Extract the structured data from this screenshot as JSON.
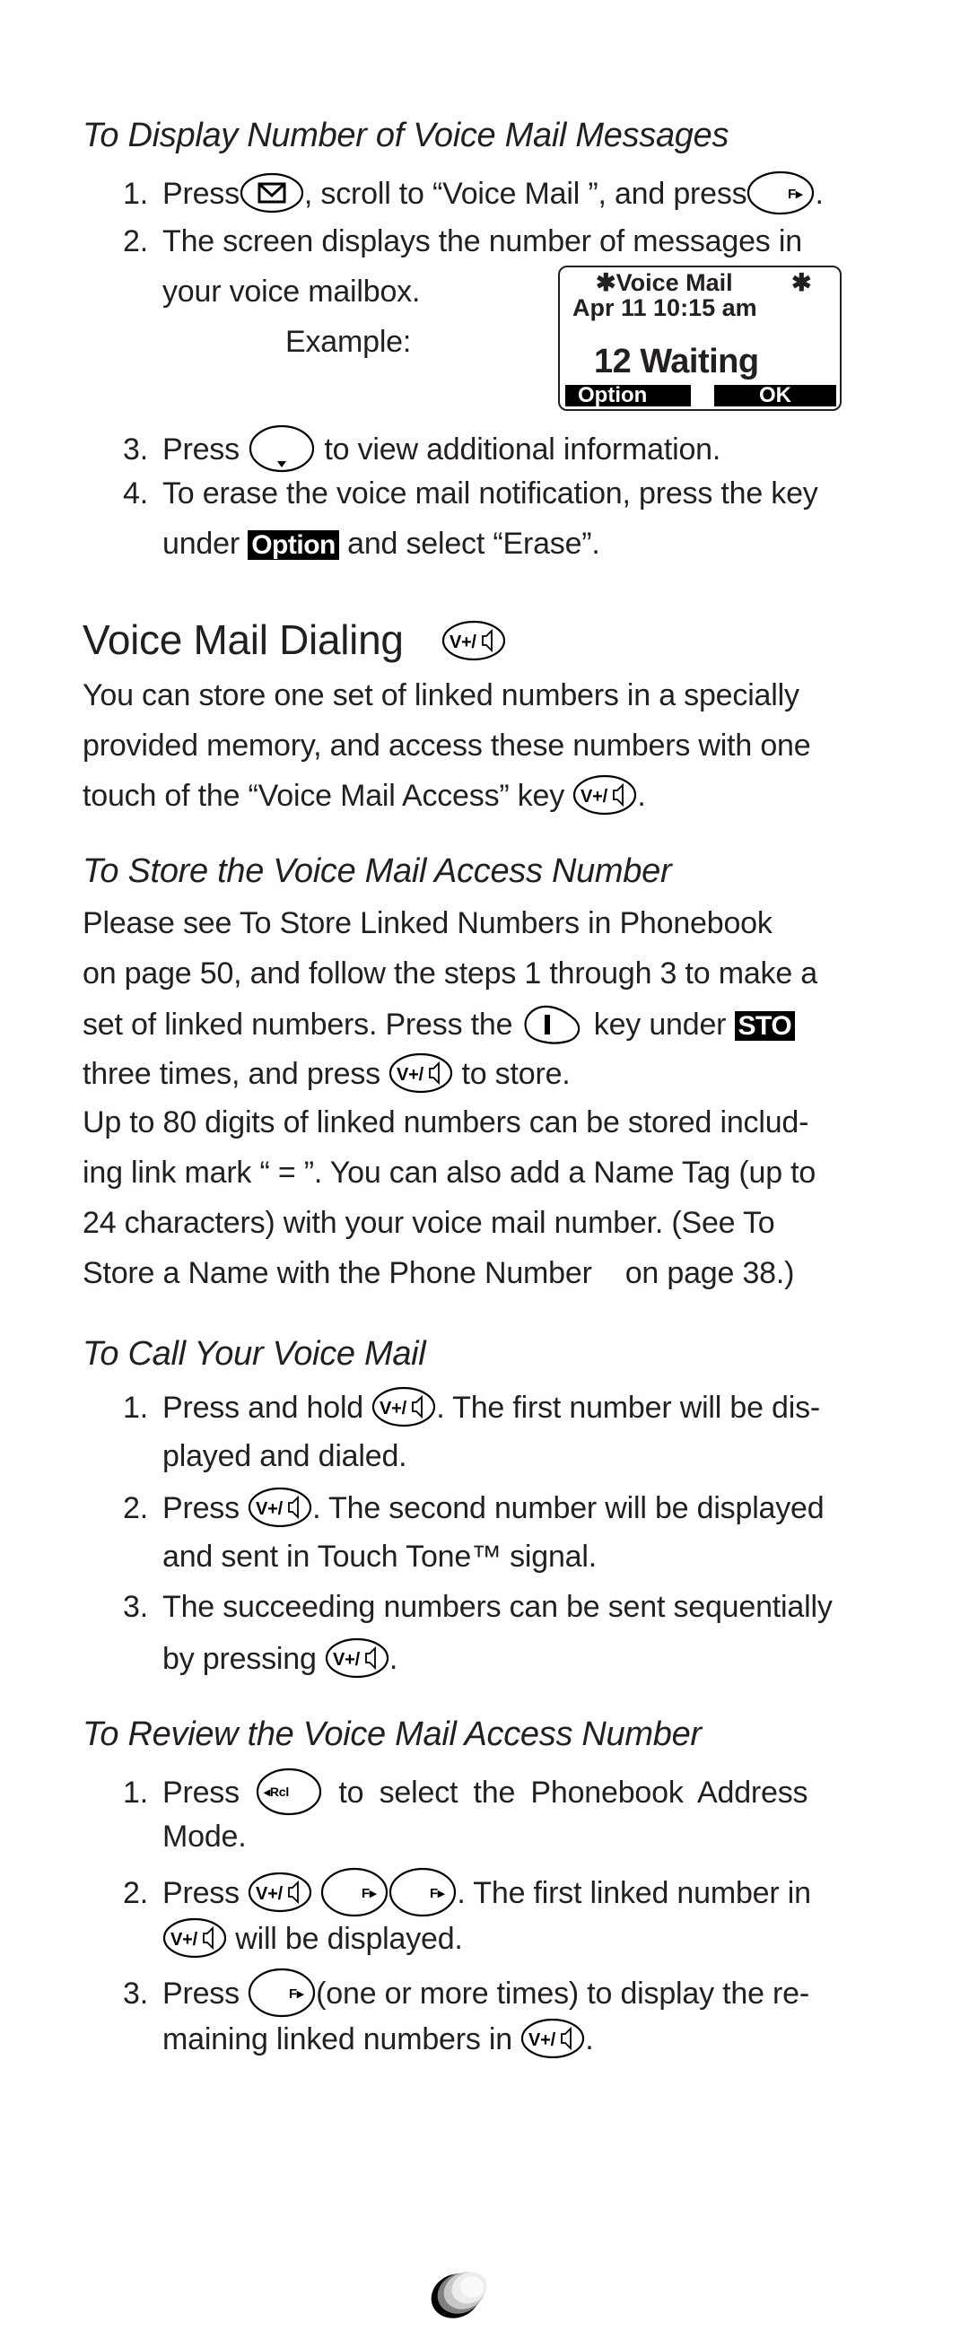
{
  "section_display": {
    "title": "To Display Number of Voice Mail Messages",
    "steps": [
      {
        "num": "1.",
        "a": "Press",
        "b": ", scroll to “Voice Mail ”, and press",
        "c": "."
      },
      {
        "num": "2.",
        "a": "The screen displays the number of messages in",
        "b": "your voice mailbox.",
        "c": "Example:"
      },
      {
        "num": "3.",
        "a": "Press",
        "b": "to view additional information."
      },
      {
        "num": "4.",
        "a": "To erase the voice mail notification, press the key",
        "b": "under",
        "badge": "Option",
        "c": "and select “Erase”."
      }
    ],
    "lcd": {
      "line1": "✱Voice Mail",
      "line1_star": "✱",
      "line2": "Apr 11 10:15 am",
      "line3": "12 Waiting",
      "softkey_left": "Option",
      "softkey_right": "OK"
    }
  },
  "section_dialing": {
    "title": "Voice Mail Dialing",
    "lines": [
      "You can store one set of linked numbers in a specially",
      "provided memory, and access these numbers with one",
      "touch of the “Voice Mail Access” key"
    ],
    "end": "."
  },
  "section_store": {
    "title": "To Store the Voice Mail Access Number",
    "lines": [
      "Please see To Store Linked Numbers in Phonebook",
      "on page 50, and follow the steps 1 through 3 to make a",
      "set of linked numbers. Press the",
      "key under",
      "three times, and press",
      "to store.",
      "Up to 80 digits of linked numbers can be stored includ-",
      "ing link mark “ = ”. You can also add a Name Tag (up to",
      "24 characters) with your voice mail number. (See To",
      "Store a Name with the Phone Number    on page 38.)"
    ],
    "badge": "STO"
  },
  "section_call": {
    "title": "To Call Your Voice Mail",
    "steps": [
      {
        "num": "1.",
        "a": "Press and hold",
        "b": ". The first number will be dis-",
        "c": "played and dialed."
      },
      {
        "num": "2.",
        "a": "Press",
        "b": ". The second number will be displayed",
        "c": "and sent in Touch Tone™ signal."
      },
      {
        "num": "3.",
        "a": "The succeeding numbers can be sent sequentially",
        "b": "by pressing",
        "c": "."
      }
    ]
  },
  "section_review": {
    "title": "To Review the Voice Mail Access Number",
    "steps": [
      {
        "num": "1.",
        "a": "Press",
        "b": "to select the Phonebook Address",
        "c": "Mode."
      },
      {
        "num": "2.",
        "a": "Press",
        "b": ". The first linked number in",
        "c": "will be displayed."
      },
      {
        "num": "3.",
        "a": "Press",
        "b": "(one or more times) to display the re-",
        "c": "maining linked numbers in",
        "d": "."
      }
    ]
  },
  "keys": {
    "mail": "mail-key",
    "f": "F▸",
    "down": "down-key",
    "vm": "V+/",
    "rcl": "◂Rcl",
    "one": "I"
  }
}
